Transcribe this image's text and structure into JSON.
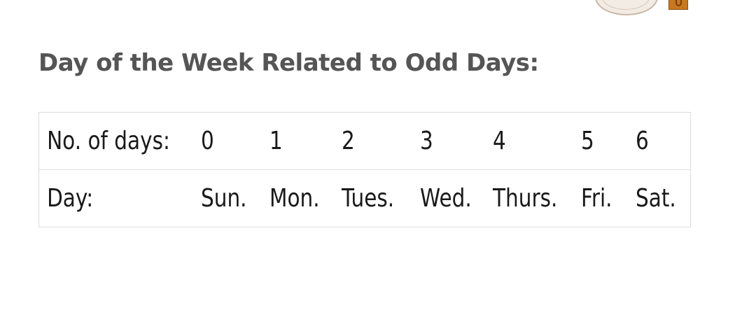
{
  "title": "Day of the Week Related to Odd Days:",
  "table": {
    "rows": [
      {
        "label": "No. of days:",
        "cells": [
          "0",
          "1",
          "2",
          "3",
          "4",
          "5",
          "6"
        ]
      },
      {
        "label": "Day:",
        "cells": [
          "Sun.",
          "Mon.",
          "Tues.",
          "Wed.",
          "Thurs.",
          "Fri.",
          "Sat."
        ]
      }
    ]
  }
}
